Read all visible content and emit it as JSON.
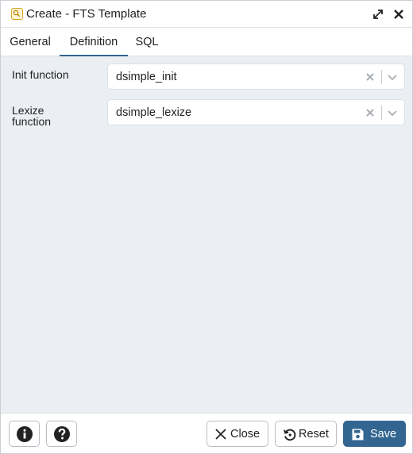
{
  "dialog": {
    "title": "Create - FTS Template",
    "title_icon": "fts-template-icon",
    "expand_icon": "expand-icon",
    "close_icon": "close-icon"
  },
  "tabs": [
    {
      "label": "General",
      "active": false
    },
    {
      "label": "Definition",
      "active": true
    },
    {
      "label": "SQL",
      "active": false
    }
  ],
  "fields": {
    "init": {
      "label": "Init function",
      "value": "dsimple_init"
    },
    "lexize": {
      "label": "Lexize function",
      "value": "dsimple_lexize"
    }
  },
  "footer": {
    "info_icon": "info-icon",
    "help_icon": "help-icon",
    "close_label": "Close",
    "reset_label": "Reset",
    "save_label": "Save"
  },
  "colors": {
    "accent": "#326690",
    "content_bg": "#ebeef3"
  }
}
